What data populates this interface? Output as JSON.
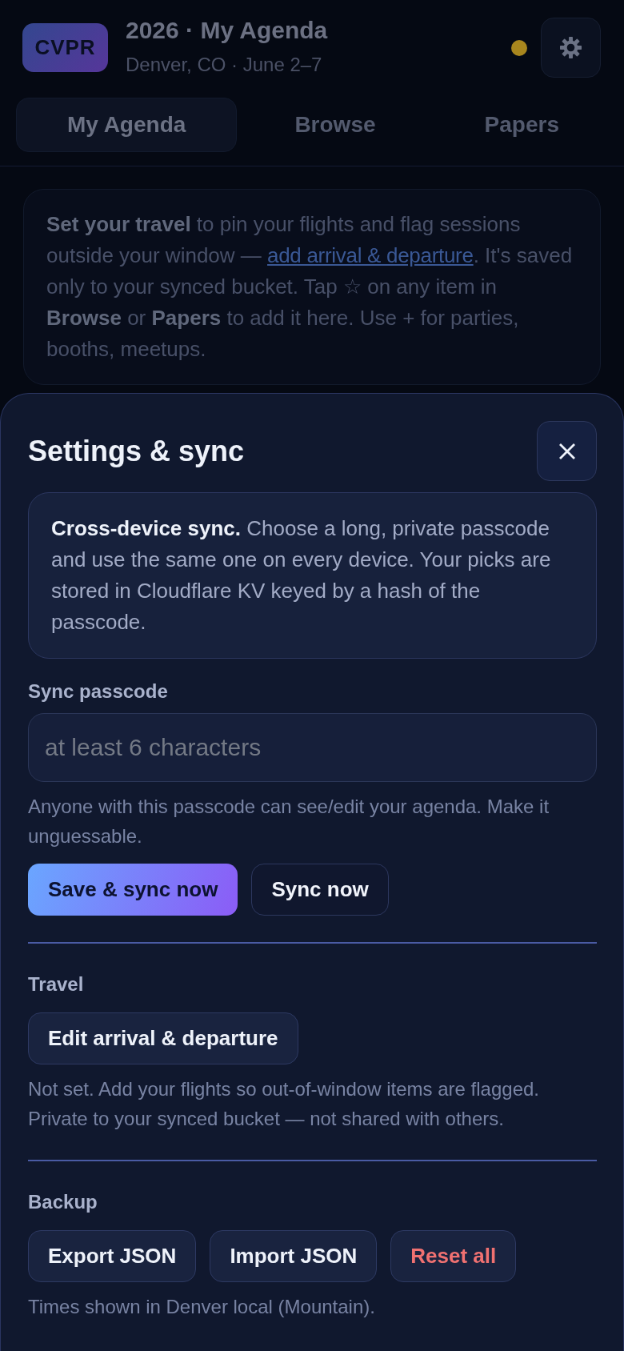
{
  "header": {
    "logo": "CVPR",
    "title": "2026 · My Agenda",
    "subtitle": "Denver, CO · June 2–7",
    "status_dot": {
      "color": "#a8861e"
    }
  },
  "tabs": [
    {
      "label": "My Agenda",
      "selected": true
    },
    {
      "label": "Browse",
      "selected": false
    },
    {
      "label": "Papers",
      "selected": false
    }
  ],
  "notice": {
    "text_before": "**Set your travel** to pin your flights and flag sessions outside your window — ",
    "link": "add arrival & departure",
    "text_after": ". It's saved only to your synced bucket. Tap ☆ on any item in **Browse** or **Papers** to add it here. Use + for parties, booths, meetups."
  },
  "settings": {
    "title": "Settings & sync",
    "info": "**Cross-device sync.** Choose a long, private passcode and use the same one on every device. Your picks are stored in Cloudflare KV keyed by a hash of the passcode.",
    "passcode": {
      "label": "Sync passcode",
      "placeholder": "at least 6 characters",
      "hint": "Anyone with this passcode can see/edit your agenda. Make it unguessable."
    },
    "sync_buttons": [
      {
        "label": "Save & sync now",
        "kind": "primary"
      },
      {
        "label": "Sync now",
        "kind": "outline"
      }
    ],
    "travel": {
      "label": "Travel",
      "buttons": [
        {
          "label": "Edit arrival & departure",
          "kind": "secondary"
        }
      ],
      "hint": "Not set. Add your flights so out-of-window items are flagged. Private to your synced bucket — not shared with others."
    },
    "backup": {
      "label": "Backup",
      "buttons": [
        {
          "label": "Export JSON",
          "kind": "secondary"
        },
        {
          "label": "Import JSON",
          "kind": "secondary"
        },
        {
          "label": "Reset all",
          "kind": "danger"
        }
      ],
      "note": "Times shown in Denver local (Mountain)."
    }
  }
}
